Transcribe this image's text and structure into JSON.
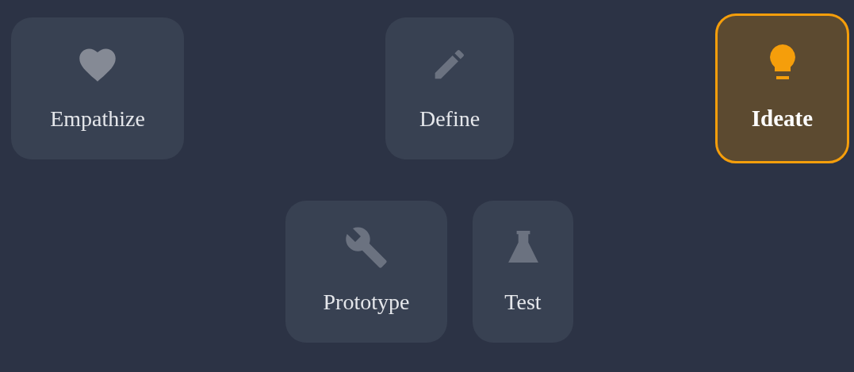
{
  "stages": [
    {
      "label": "Empathize",
      "kind": "heart",
      "selected": false
    },
    {
      "label": "Define",
      "kind": "pencil",
      "selected": false
    },
    {
      "label": "Ideate",
      "kind": "bulb",
      "selected": true
    },
    {
      "label": "Prototype",
      "kind": "wrench",
      "selected": false
    },
    {
      "label": "Test",
      "kind": "flask",
      "selected": false
    }
  ]
}
